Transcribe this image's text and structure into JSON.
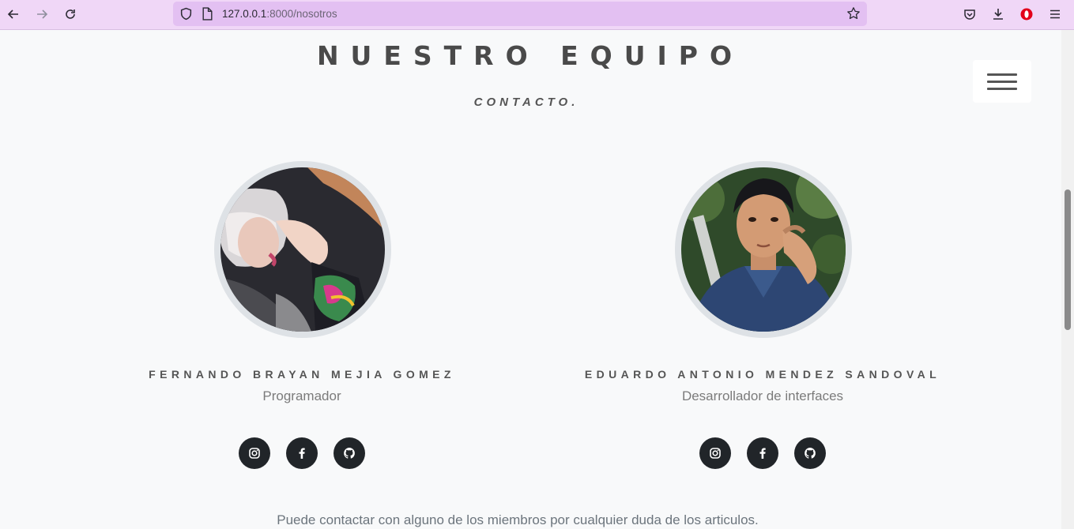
{
  "browser": {
    "url_host": "127.0.0.1",
    "url_path": ":8000/nosotros",
    "icons": [
      "back-icon",
      "forward-icon",
      "reload-icon",
      "shield-icon",
      "page-icon",
      "bookmark-star-icon",
      "pocket-icon",
      "download-icon",
      "opera-icon",
      "hamburger-menu-icon"
    ]
  },
  "section": {
    "title": "NUESTRO EQUIPO",
    "subtitle": "CONTACTO."
  },
  "members": [
    {
      "name": "FERNANDO BRAYAN MEJIA GOMEZ",
      "role": "Programador",
      "socials": [
        "instagram-icon",
        "facebook-icon",
        "github-icon"
      ]
    },
    {
      "name": "EDUARDO ANTONIO MENDEZ SANDOVAL",
      "role": "Desarrollador de interfaces",
      "socials": [
        "instagram-icon",
        "facebook-icon",
        "github-icon"
      ]
    }
  ],
  "footer": {
    "note": "Puede contactar con alguno de los miembros por cualquier duda de los articulos."
  },
  "colors": {
    "toolbar_bg": "#f0d7f7",
    "urlbar_bg": "#e3c0f2",
    "page_bg": "#f8f9fa",
    "social_bg": "#212529",
    "title_text": "#4a4a4a"
  }
}
